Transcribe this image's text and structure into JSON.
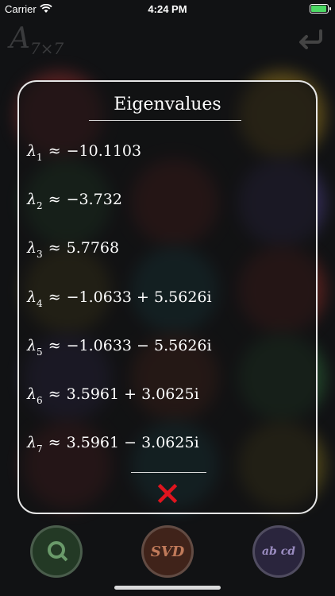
{
  "status_bar": {
    "carrier": "Carrier",
    "time": "4:24 PM"
  },
  "header": {
    "matrix_symbol": "A",
    "matrix_size": "7×7",
    "back_icon": "back-arrow-icon"
  },
  "dialog": {
    "title": "Eigenvalues",
    "rows": [
      {
        "symbol": "λ",
        "index": "1",
        "approx": "≈",
        "value": "−10.1103"
      },
      {
        "symbol": "λ",
        "index": "2",
        "approx": "≈",
        "value": "−3.732"
      },
      {
        "symbol": "λ",
        "index": "3",
        "approx": "≈",
        "value": "5.7768"
      },
      {
        "symbol": "λ",
        "index": "4",
        "approx": "≈",
        "value": "−1.0633 + 5.5626i"
      },
      {
        "symbol": "λ",
        "index": "5",
        "approx": "≈",
        "value": "−1.0633 − 5.5626i"
      },
      {
        "symbol": "λ",
        "index": "6",
        "approx": "≈",
        "value": "3.5961 + 3.0625i"
      },
      {
        "symbol": "λ",
        "index": "7",
        "approx": "≈",
        "value": "3.5961 − 3.0625i"
      }
    ],
    "close_icon": "close-x-icon",
    "close_color": "#e0141e"
  },
  "bottom_buttons": [
    {
      "label": "",
      "icon": "search-grid-icon",
      "color": "#3a6b3a"
    },
    {
      "label": "SVD",
      "icon": "svd-icon",
      "color": "#7a3a22"
    },
    {
      "label": "ab cd",
      "icon": "matrix-transpose-icon",
      "color": "#4a3e6e"
    }
  ]
}
